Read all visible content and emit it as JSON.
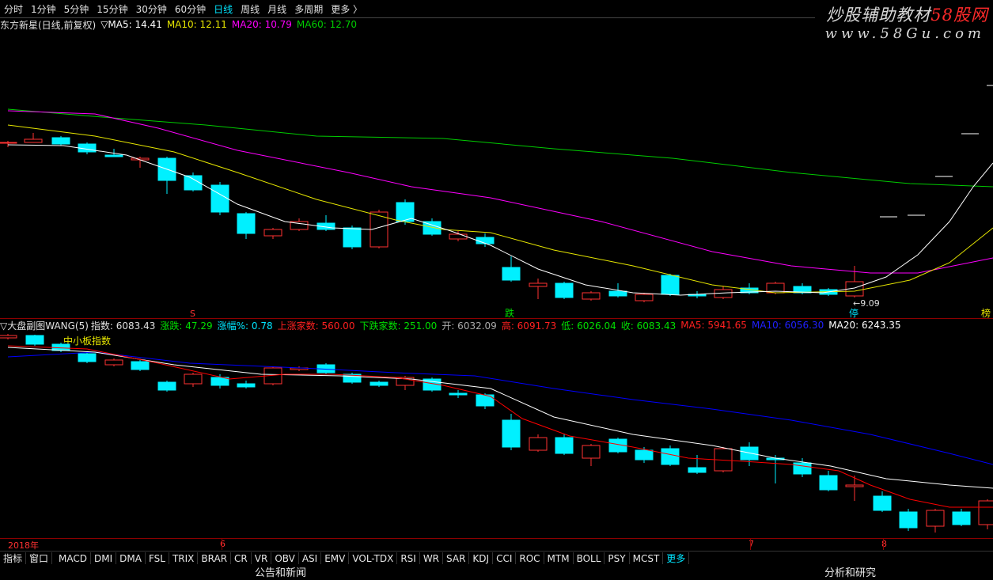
{
  "toolbar": {
    "periods": [
      "分时",
      "1分钟",
      "5分钟",
      "15分钟",
      "30分钟",
      "60分钟",
      "日线",
      "周线",
      "月线",
      "多周期",
      "更多 〉"
    ],
    "active_index": 6
  },
  "main_legend": {
    "title": "东方新星(日线,前复权)",
    "ma5": "▽MA5: 14.41",
    "ma10": "MA10: 12.11",
    "ma20": "MA20: 10.79",
    "ma60": "MA60: 12.70"
  },
  "watermark": {
    "line1": "炒股辅助教材",
    "line1_red": "58股网",
    "line2": "www.58Gu.com"
  },
  "main_markers": {
    "s_marker": "S",
    "die_marker": "跌",
    "ting_marker": "停",
    "bang_marker": "榜",
    "low_label": "←9.09"
  },
  "sub_legend": {
    "title": "▽大盘副图WANG(5)",
    "index": "指数: 6083.43",
    "change": "涨跌: 47.29",
    "pct": "涨幅%: 0.78",
    "up_count": "上涨家数: 560.00",
    "down_count": "下跌家数: 251.00",
    "open": "开: 6032.09",
    "high": "高: 6091.73",
    "low": "低: 6026.04",
    "close": "收: 6083.43",
    "ma5": "MA5: 5941.65",
    "ma10": "MA10: 6056.30",
    "ma20": "MA20: 6243.35",
    "index_name": "中小板指数"
  },
  "date_axis": {
    "year": "2018年",
    "m6": "6",
    "m7": "7",
    "m8": "8"
  },
  "indicator_bar": {
    "items": [
      "指标",
      "窗口",
      "MACD",
      "DMI",
      "DMA",
      "FSL",
      "TRIX",
      "BRAR",
      "CR",
      "VR",
      "OBV",
      "ASI",
      "EMV",
      "VOL-TDX",
      "RSI",
      "WR",
      "SAR",
      "KDJ",
      "CCI",
      "ROC",
      "MTM",
      "BOLL",
      "PSY",
      "MCST",
      "更多"
    ]
  },
  "bottom_links": {
    "left": "公告和新闻",
    "right": "分析和研究"
  },
  "colors": {
    "up": "#ff3232",
    "down": "#00f0ff",
    "ma5": "#ffffff",
    "ma10": "#e6e600",
    "ma20": "#ff00ff",
    "ma60": "#00cc00",
    "sub_ma5": "#ffffff",
    "sub_ma10": "#ff0000",
    "sub_ma20": "#0000ff"
  }
}
